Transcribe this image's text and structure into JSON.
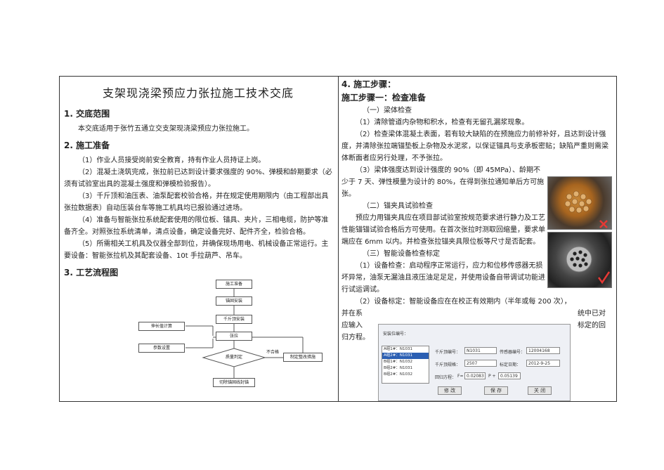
{
  "title": "支架现浇梁预应力张拉施工技术交底",
  "left": {
    "s1_heading": "1. 交底范围",
    "s1_text": "本交底适用于张竹五通立交支架现浇梁预应力张拉施工。",
    "s2_heading": "2. 施工准备",
    "s2_p1": "（1）作业人员接受岗前安全教育，持有作业人员持证上岗。",
    "s2_p2": "（2）混凝土浇筑完成，张拉前已达到设计要求强度的 90%、弹模和龄期要求（必须有试验室出具的混凝土强度和弹模检验报告）。",
    "s2_p3": "（3）千斤顶和油压表、油泵配套校验合格，并在规定使用期限内（由工程部出具张拉数据表）自动压装台车等施工机具均已报验通过进场。",
    "s2_p4": "（4）准备与智能张拉系统配套使用的限位板、锚具、夹片，三相电缆，防护等准备齐全。对照张拉系统清单，清点设备，确定设备完好、配件齐全，检验合格。",
    "s2_p5": "（5）所需相关工机具及仪器全部到位，并确保现场用电、机械设备正常运行。主要设备：智能张拉机及其配套设备、10t 手拉葫芦、吊车。",
    "s3_heading": "3. 工艺流程图"
  },
  "flow": {
    "n1": "施工准备",
    "n2": "锚固安装",
    "n3": "千斤顶安装",
    "n4": "张拉",
    "n5": "质量判定",
    "n6": "切除锚固线封锚",
    "side1": "伸长值计算",
    "side2": "参数设置",
    "fail_label": "不合格",
    "fix": "制定整改措施"
  },
  "right": {
    "s4_heading": "4. 施工步骤：",
    "step1_heading": "施工步骤一：检查准备",
    "a_title": "（一）梁体检查",
    "a_p1": "（1）清除管道内杂物和积水，检查有无留孔漏浆现象。",
    "a_p2": "（2）检查梁体混凝土表面，若有较大缺陷的在预施应力前修补好，且达到设计强度，并清除张拉端锚垫板上杂物及水泥浆，以保证锚具与支承板密贴；缺陷严重则需梁体断面者应另行处理，不予张拉。",
    "a_p3": "（3）梁体强度达到设计强度的 90%（即 45MPa）、龄期不少于 7 天、弹性模量为设计的 80%，在得到张拉通知单后方可施张。",
    "b_title": "（二）锚夹具试验检查",
    "b_p1": "预应力用锚夹具应在项目部试验室按规范要求进行静力及工艺性能锚锚试验合格后方可使用。在首次张拉时测取回缩量，要求单端应在 6mm 以内。并检查张拉锚夹具限位板等尺寸是否配套。",
    "c_title": "（三）智能设备检查标定",
    "c_p1": "（1）设备检查：启动程序正常运行，应力和位移传感器无损坏异常，油泵无漏油且液压油足足足，并使用设备自带调试功能进行试运调试。",
    "c_p2": "（2）设备标定：智能设备应在在校正有效期内（半年或每 200 次），",
    "c_p3_a": "并在系",
    "c_p3_b": "统中已对",
    "c_p4_a": "应输入",
    "c_p4_b": "标定的回",
    "c_p5_a": "归方程。"
  },
  "dialog": {
    "header": "安装位编号：",
    "list": [
      "A组1#：N1031",
      "A组2#：N1031",
      "B组1#：N1032",
      "B组2#：N1031",
      "B组2#：N1032"
    ],
    "jack_label": "千斤顶编号：",
    "jack_value": "N1031",
    "sensor_label": "传感器编号：",
    "sensor_value": "12004168",
    "spec_label": "千斤顶规格：",
    "spec_value": "2507",
    "date_label": "标定日期：",
    "date_value": "2012-9-25",
    "eq_label": "回归方程：",
    "eq_f": "0.02083",
    "eq_p": "0.05139",
    "btn_edit": "修 改",
    "btn_save": "保 存",
    "btn_close": "关 闭"
  },
  "colors": {
    "cross": "#e53935",
    "check": "#e53935"
  }
}
